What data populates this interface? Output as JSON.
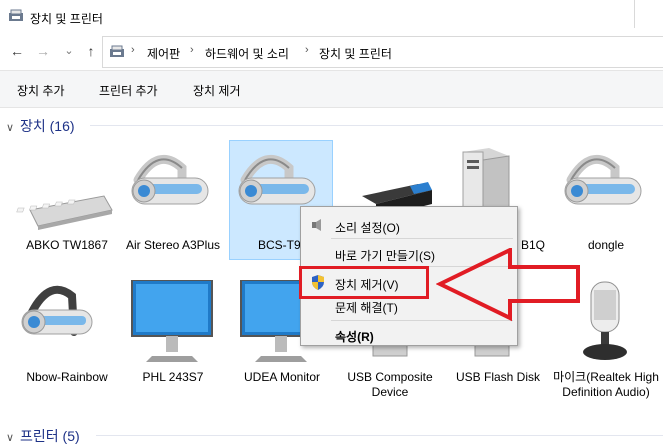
{
  "window": {
    "title": "장치 및 프린터"
  },
  "nav": {
    "back": "←",
    "forward": "→",
    "recent": "⌄",
    "up": "↑",
    "breadcrumbs": [
      "제어판",
      "하드웨어 및 소리",
      "장치 및 프린터"
    ],
    "separator": "›"
  },
  "commands": {
    "add_device": "장치 추가",
    "add_printer": "프린터 추가",
    "remove_device": "장치 제거"
  },
  "groups": {
    "devices": {
      "label": "장치 (16)"
    },
    "printers": {
      "label": "프린터 (5)"
    }
  },
  "devices": [
    {
      "label": "ABKO TW1867",
      "icon": "keyboard-icon"
    },
    {
      "label": "Air Stereo A3Plus",
      "icon": "headset-icon"
    },
    {
      "label": "BCS-T9",
      "icon": "headset-icon"
    },
    {
      "label": "",
      "icon": "portable-drive-icon"
    },
    {
      "label": "B1Q",
      "icon": "computer-tower-icon"
    },
    {
      "label": "dongle",
      "icon": "headset-icon"
    },
    {
      "label": "Nbow-Rainbow",
      "icon": "headset-icon"
    },
    {
      "label": "PHL 243S7",
      "icon": "monitor-icon"
    },
    {
      "label": "UDEA Monitor",
      "icon": "monitor-icon"
    },
    {
      "label": "USB Composite Device",
      "icon": "usb-device-icon"
    },
    {
      "label": "USB Flash Disk",
      "icon": "usb-device-icon"
    },
    {
      "label": "마이크(Realtek High Definition Audio)",
      "icon": "microphone-icon"
    }
  ],
  "context_menu": {
    "items": [
      {
        "label": "소리 설정(O)",
        "icon": "speaker-icon"
      },
      {
        "label": "바로 가기 만들기(S)"
      },
      {
        "label": "장치 제거(V)",
        "icon": "uac-shield-icon"
      },
      {
        "label": "문제 해결(T)"
      },
      {
        "label": "속성(R)"
      }
    ]
  },
  "colors": {
    "accent": "#1e3287",
    "selection": "#cce8ff",
    "annotation": "#e11c24"
  }
}
